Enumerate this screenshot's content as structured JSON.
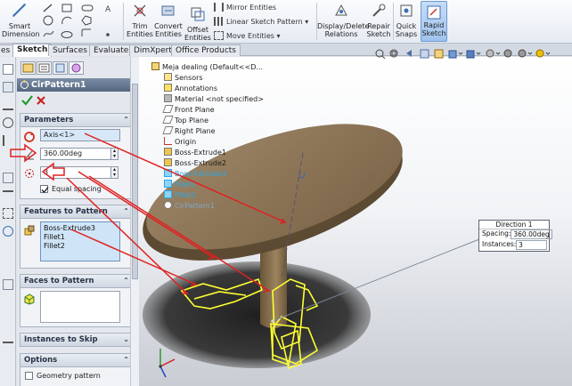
{
  "ribbon": {
    "smart_dimension": "Smart Dimension",
    "trim_entities": "Trim Entities",
    "convert_entities": "Convert Entities",
    "offset_entities": "Offset Entities",
    "mirror_entities": "Mirror Entities",
    "linear_sketch_pattern": "Linear Sketch Pattern",
    "move_entities": "Move Entities",
    "display_delete_relations": "Display/Delete Relations",
    "repair_sketch": "Repair Sketch",
    "quick_snaps": "Quick Snaps",
    "rapid_sketch": "Rapid Sketch"
  },
  "tabs": [
    "es",
    "Sketch",
    "Surfaces",
    "Evaluate",
    "DimXpert",
    "Office Products"
  ],
  "active_tab": "Sketch",
  "property_manager": {
    "title": "CirPattern1",
    "help": "?",
    "parameters": {
      "header": "Parameters",
      "axis": "Axis<1>",
      "angle": "360.00deg",
      "instances": "3",
      "equal_spacing_label": "Equal spacing",
      "equal_spacing_checked": true
    },
    "features_to_pattern": {
      "header": "Features to Pattern",
      "items": [
        "Boss-Extrude3",
        "Fillet1",
        "Fillet2"
      ]
    },
    "faces_to_pattern": {
      "header": "Faces to Pattern"
    },
    "instances_to_skip": {
      "header": "Instances to Skip"
    },
    "options": {
      "header": "Options",
      "geometry_pattern_label": "Geometry pattern"
    }
  },
  "tree": {
    "root": "Meja dealing  (Default<<D...",
    "items": [
      "Sensors",
      "Annotations",
      "Material <not specified>",
      "Front Plane",
      "Top Plane",
      "Right Plane",
      "Origin",
      "Boss-Extrude1",
      "Boss-Extrude2",
      "Boss-Extrude3",
      "Fillet1",
      "Fillet2",
      "CirPattern1"
    ]
  },
  "callout": {
    "title": "Direction 1",
    "spacing_label": "Spacing:",
    "spacing_value": "360.00deg",
    "instances_label": "Instances:",
    "instances_value": "3"
  },
  "colors": {
    "table_wood": "#8d7457",
    "selection_yellow": "#ffff33",
    "annotation_red": "#e02020",
    "title_bar": "#5d6f88"
  }
}
